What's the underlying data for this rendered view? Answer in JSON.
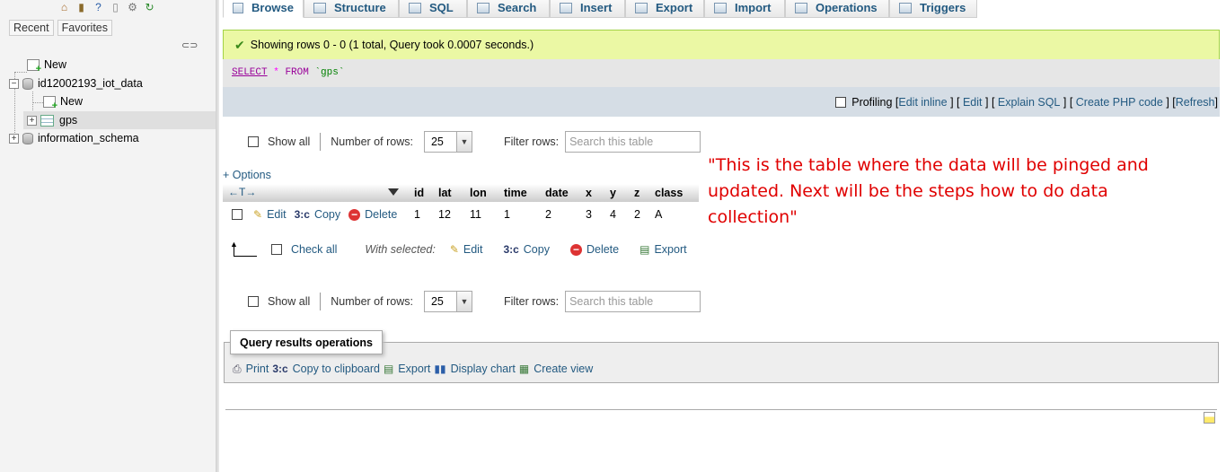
{
  "sidebar": {
    "tabs": [
      "Recent",
      "Favorites"
    ],
    "tree": {
      "new_label": "New",
      "db1": "id12002193_iot_data",
      "db1_new": "New",
      "db1_table": "gps",
      "db2": "information_schema"
    }
  },
  "top_tabs": [
    "Browse",
    "Structure",
    "SQL",
    "Search",
    "Insert",
    "Export",
    "Import",
    "Operations",
    "Triggers"
  ],
  "success_message": "Showing rows 0 - 0 (1 total, Query took 0.0007 seconds.)",
  "sql": {
    "select": "SELECT",
    "star": "*",
    "from": "FROM",
    "table": "`gps`"
  },
  "sql_actions": {
    "profiling": "Profiling",
    "bracket_open": "[",
    "bracket_sep": "] [",
    "bracket_close": "]",
    "edit_inline": "Edit inline",
    "edit": "Edit",
    "explain": "Explain SQL",
    "php": "Create PHP code",
    "refresh": "Refresh"
  },
  "nav_row": {
    "show_all": "Show all",
    "number_of_rows": "Number of rows:",
    "rows_value": "25",
    "filter_rows": "Filter rows:",
    "filter_placeholder": "Search this table"
  },
  "options_link": "+ Options",
  "table": {
    "columns": [
      "id",
      "lat",
      "lon",
      "time",
      "date",
      "x",
      "y",
      "z",
      "class"
    ],
    "rows": [
      {
        "id": "1",
        "lat": "12",
        "lon": "11",
        "time": "1",
        "date": "2",
        "x": "3",
        "y": "4",
        "z": "2",
        "class": "A"
      }
    ],
    "row_actions": {
      "edit": "Edit",
      "copy": "Copy",
      "delete": "Delete"
    }
  },
  "with_selected": {
    "check_all": "Check all",
    "label": "With selected:",
    "edit": "Edit",
    "copy": "Copy",
    "delete": "Delete",
    "export": "Export"
  },
  "annotation": "\"This is the table where the data will be pinged and updated. Next will be the steps how to do data collection\"",
  "query_ops": {
    "title": "Query results operations",
    "print": "Print",
    "copy": "Copy to clipboard",
    "export": "Export",
    "chart": "Display chart",
    "view": "Create view"
  }
}
